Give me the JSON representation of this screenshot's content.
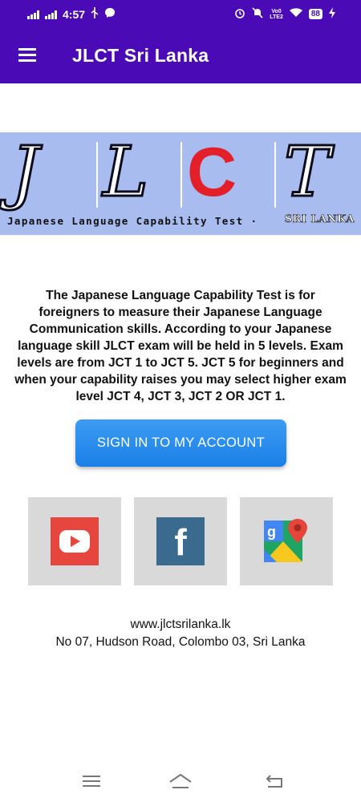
{
  "status_bar": {
    "time": "4:57",
    "battery": "88",
    "volte": "Vo0\nLTE2",
    "icons": [
      "signal-icon",
      "usb-icon",
      "messenger-icon",
      "alarm-icon",
      "mute-icon",
      "volte-icon",
      "wifi-icon",
      "battery-icon",
      "charging-icon"
    ]
  },
  "app_bar": {
    "title": "JLCT Sri Lanka",
    "menu_icon": "hamburger-menu-icon"
  },
  "banner": {
    "letters": [
      "J",
      "L",
      "C",
      "T"
    ],
    "caption": "Japanese Language Capability Test ·",
    "badge": "SRI LANKA"
  },
  "description": "The Japanese Language Capability Test is for foreigners to measure their Japanese Language Communication skills. According to your Japanese language skill JLCT exam will be held in 5 levels. Exam levels are from JCT 1 to JCT 5. JCT 5 for beginners and when your capability raises you may select higher exam level JCT 4, JCT 3, JCT 2 OR JCT 1.",
  "signin_button": "SIGN IN TO MY ACCOUNT",
  "social": {
    "youtube_icon": "youtube-icon",
    "facebook_icon": "facebook-icon",
    "facebook_glyph": "f",
    "maps_icon": "google-maps-icon",
    "maps_glyph": "g"
  },
  "footer": {
    "url": "www.jlctsrilanka.lk",
    "address": "No 07, Hudson Road, Colombo 03, Sri Lanka"
  },
  "nav_bar": {
    "icons": [
      "recent-apps-icon",
      "home-icon",
      "back-icon"
    ]
  },
  "colors": {
    "primary": "#4a0ab5",
    "button": "#2a8cef",
    "banner_bg": "#a9bcf0",
    "tile_bg": "#d9d9d9"
  }
}
